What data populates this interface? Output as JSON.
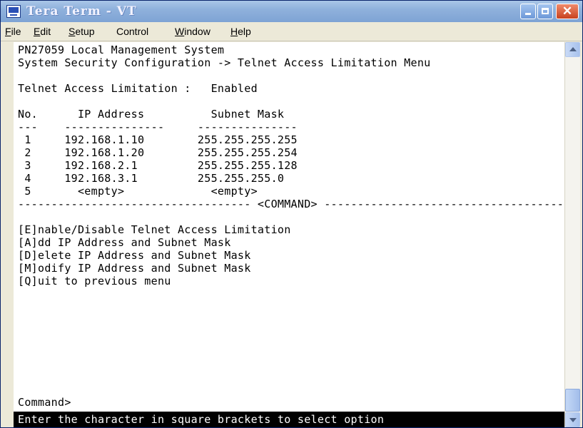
{
  "window": {
    "title": "Tera Term - VT",
    "close_glyph": "✕"
  },
  "menu": [
    {
      "label": "ile",
      "mnemonic": "F"
    },
    {
      "label": "dit",
      "mnemonic": "E"
    },
    {
      "label": "etup",
      "mnemonic": "S"
    },
    {
      "label": "Control"
    },
    {
      "label": "indow",
      "mnemonic": "W"
    },
    {
      "label": "elp",
      "mnemonic": "H"
    }
  ],
  "terminal": {
    "lines": [
      "PN27059 Local Management System",
      "System Security Configuration -> Telnet Access Limitation Menu",
      "",
      "Telnet Access Limitation :   Enabled",
      "",
      "No.      IP Address          Subnet Mask",
      "---    ---------------     ---------------",
      " 1     192.168.1.10        255.255.255.255",
      " 2     192.168.1.20        255.255.255.254",
      " 3     192.168.2.1         255.255.255.128",
      " 4     192.168.3.1         255.255.255.0",
      " 5       <empty>             <empty>",
      "----------------------------------- <COMMAND> ------------------------------------",
      "",
      "[E]nable/Disable Telnet Access Limitation",
      "[A]dd IP Address and Subnet Mask",
      "[D]elete IP Address and Subnet Mask",
      "[M]odify IP Address and Subnet Mask",
      "[Q]uit to previous menu",
      "",
      "",
      "",
      "",
      "",
      "Command>"
    ],
    "status": "Enter the character in square brackets to select option"
  }
}
